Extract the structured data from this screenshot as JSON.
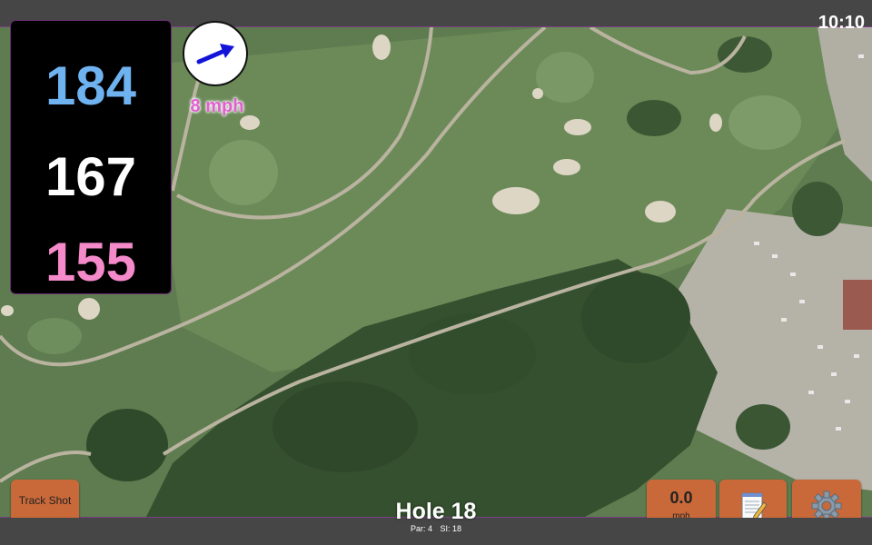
{
  "status": {
    "time": "10:10"
  },
  "distances": {
    "back": "184",
    "middle": "167",
    "front": "155"
  },
  "wind": {
    "speed": "8 mph",
    "direction_icon": "arrow-right-icon"
  },
  "buttons": {
    "track_shot": "Track Shot",
    "speed_value": "0.0",
    "speed_unit": "mph",
    "notes_icon": "notepad-icon",
    "settings_icon": "gear-icon"
  },
  "hole": {
    "title": "Hole 18",
    "par": "Par: 4",
    "si": "SI: 18"
  },
  "colors": {
    "back": "#6fb2f0",
    "middle": "#ffffff",
    "front": "#f48ac9",
    "wind": "#e15fd0",
    "button": "#c9693a"
  }
}
